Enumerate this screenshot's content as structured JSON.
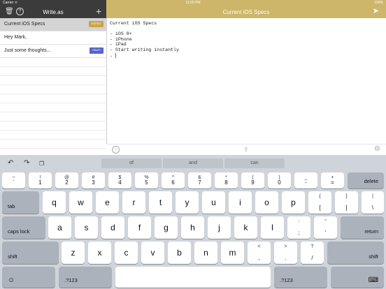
{
  "status_bar": {
    "carrier": "Carrier ᯤ",
    "time": "11:00 PM",
    "battery": "100%"
  },
  "sidebar": {
    "title": "Write.as",
    "posts": [
      {
        "title": "Current iOS Specs",
        "badge": "EDITED",
        "badge_color": "#c9a64a"
      },
      {
        "title": "Hey Mark,",
        "badge": "",
        "badge_color": ""
      },
      {
        "title": "Just some thoughts...",
        "badge": "DRAFT",
        "badge_color": "#5865c8"
      }
    ]
  },
  "editor": {
    "title": "Current iOS Specs",
    "lines": [
      "Current iOS Specs",
      "",
      "- iOS 8+",
      "- iPhone",
      "- iPad",
      "- Start writing instantly",
      "- "
    ]
  },
  "keyboard": {
    "suggestions": [
      "of",
      "and",
      "can"
    ],
    "row1": [
      {
        "top": "~",
        "bottom": "`"
      },
      {
        "top": "!",
        "bottom": "1"
      },
      {
        "top": "@",
        "bottom": "2"
      },
      {
        "top": "#",
        "bottom": "3"
      },
      {
        "top": "$",
        "bottom": "4"
      },
      {
        "top": "%",
        "bottom": "5"
      },
      {
        "top": "^",
        "bottom": "6"
      },
      {
        "top": "&",
        "bottom": "7"
      },
      {
        "top": "*",
        "bottom": "8"
      },
      {
        "top": "(",
        "bottom": "9"
      },
      {
        "top": ")",
        "bottom": "0"
      },
      {
        "top": "_",
        "bottom": "-"
      },
      {
        "top": "+",
        "bottom": "="
      }
    ],
    "delete_label": "delete",
    "tab_label": "tab",
    "row2": [
      "q",
      "w",
      "e",
      "r",
      "t",
      "y",
      "u",
      "i",
      "o",
      "p"
    ],
    "row2_sym": [
      {
        "top": "{",
        "bottom": "["
      },
      {
        "top": "}",
        "bottom": "]"
      },
      {
        "top": "|",
        "bottom": "\\"
      }
    ],
    "caps_label": "caps lock",
    "row3": [
      "a",
      "s",
      "d",
      "f",
      "g",
      "h",
      "j",
      "k",
      "l"
    ],
    "row3_sym": [
      {
        "top": ":",
        "bottom": ";"
      },
      {
        "top": "\"",
        "bottom": "'"
      }
    ],
    "return_label": "return",
    "shift_label": "shift",
    "row4": [
      "z",
      "x",
      "c",
      "v",
      "b",
      "n",
      "m"
    ],
    "row4_sym": [
      {
        "top": "<",
        "bottom": ","
      },
      {
        "top": ">",
        "bottom": "."
      },
      {
        "top": "?",
        "bottom": "/"
      }
    ],
    "numbers_label": ".?123"
  }
}
